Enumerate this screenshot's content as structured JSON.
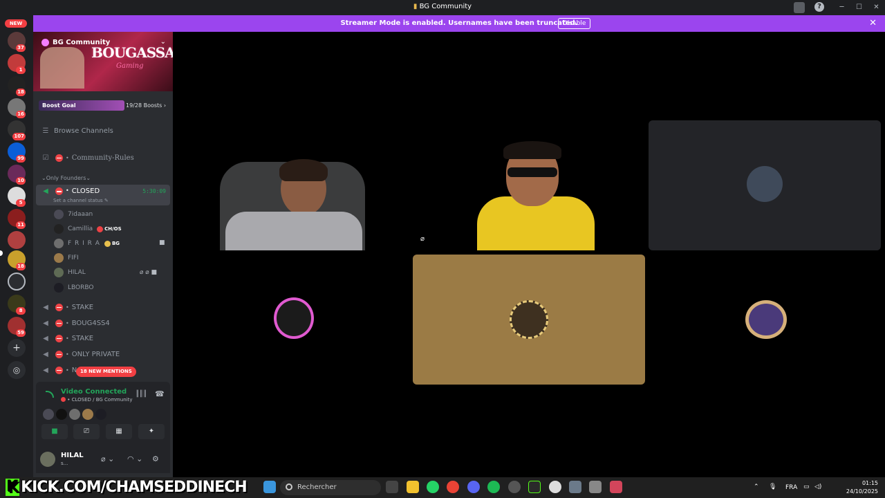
{
  "window": {
    "title": "BG Community"
  },
  "banner": {
    "text": "Streamer Mode is enabled. Usernames have been truncated.",
    "button": "Disable"
  },
  "rail": {
    "new_label": "NEW",
    "badges": [
      "37",
      "1",
      "18",
      "16",
      "107",
      "99",
      "10",
      "5",
      "11",
      "18",
      "8",
      "59"
    ]
  },
  "server": {
    "name": "BG Community",
    "banner_text": "BOUGASSAA",
    "banner_sub": "Gaming",
    "boost_label": "Boost Goal",
    "boost_count": "19/28 Boosts",
    "boost_progress": 0.68
  },
  "channels": {
    "browse": "Browse Channels",
    "rules": "Community-Rules",
    "category": "Only Founders",
    "active": {
      "name": "CLOSED",
      "timer": "5:30:09",
      "status": "Set a channel status"
    },
    "members": [
      {
        "name": "7idaaan",
        "tag": ""
      },
      {
        "name": "Camillia",
        "tag": "CH/OS"
      },
      {
        "name": "F R I R A",
        "tag": "BG"
      },
      {
        "name": "FIFI",
        "tag": ""
      },
      {
        "name": "HILAL",
        "tag": ""
      },
      {
        "name": "LBORBO",
        "tag": ""
      }
    ],
    "voice": [
      "STAKE",
      "BOUG4SS4",
      "STAKE",
      "ONLY PRIVATE",
      "N"
    ],
    "mentions": "18 NEW MENTIONS"
  },
  "voice_panel": {
    "status": "Video Connected",
    "location": "CLOSED / BG Community"
  },
  "user": {
    "name": "HILAL",
    "status": "s..."
  },
  "taskbar": {
    "stream_url": "KICK.COM/CHAMSEDDINECH",
    "search_placeholder": "Rechercher",
    "lang": "FRA",
    "time": "01:15",
    "date": "24/10/2025"
  },
  "colors": {
    "accent": "#9b45ee",
    "online": "#23a55a",
    "danger": "#f23f43",
    "kick": "#53fc18"
  }
}
